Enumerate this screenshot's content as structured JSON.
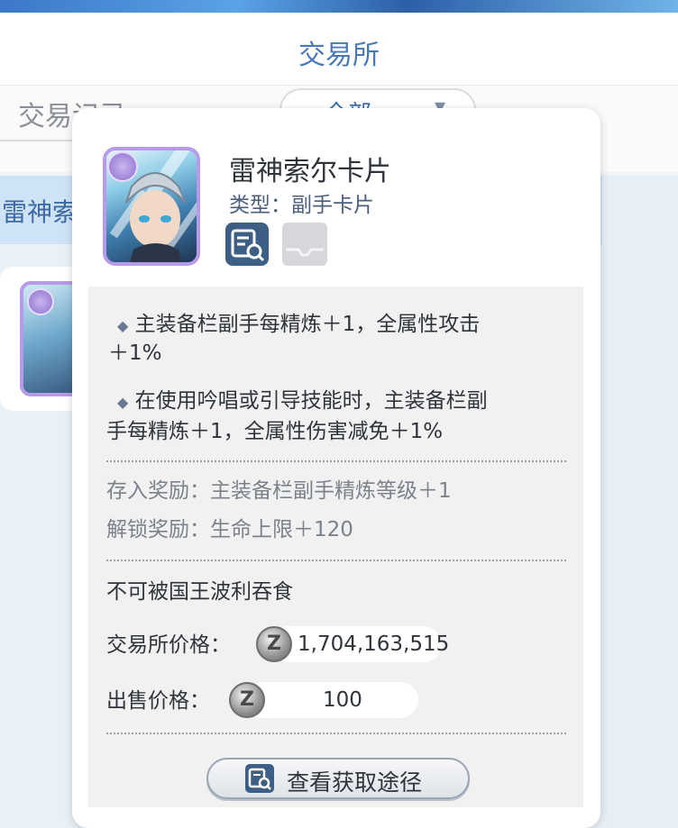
{
  "background": {
    "page_title": "交易所",
    "record_tab": "交易记录",
    "filter": {
      "value": "全部",
      "chevron": "▾"
    },
    "list_header": "雷神索"
  },
  "item": {
    "name": "雷神索尔卡片",
    "type": "类型：副手卡片",
    "effects": [
      {
        "line1": "主装备栏副手每精炼＋1，全属性攻击",
        "line2": "＋1%"
      },
      {
        "line1": "在使用吟唱或引导技能时，主装备栏副",
        "line2": "手每精炼＋1，全属性伤害减免＋1%"
      }
    ],
    "deposit_reward": "存入奖励：主装备栏副手精炼等级＋1",
    "unlock_reward": "解锁奖励：生命上限＋120",
    "note": "不可被国王波利吞食",
    "exchange_price": {
      "label": "交易所价格：",
      "value": "1,704,163,515",
      "currency_symbol": "Z"
    },
    "sell_price": {
      "label": "出售价格：",
      "value": "100",
      "currency_symbol": "Z"
    },
    "route_button": "查看获取途径"
  },
  "icons": {
    "bullet": "◆",
    "card_badge": "shield-badge-icon",
    "search": "magnify-document-icon",
    "tray": "inbox-tray-icon",
    "currency": "zeny-coin-icon"
  },
  "colors": {
    "accent": "#4a79b8",
    "card_border": "#b79ae8",
    "panel": "#f1f1f2"
  }
}
